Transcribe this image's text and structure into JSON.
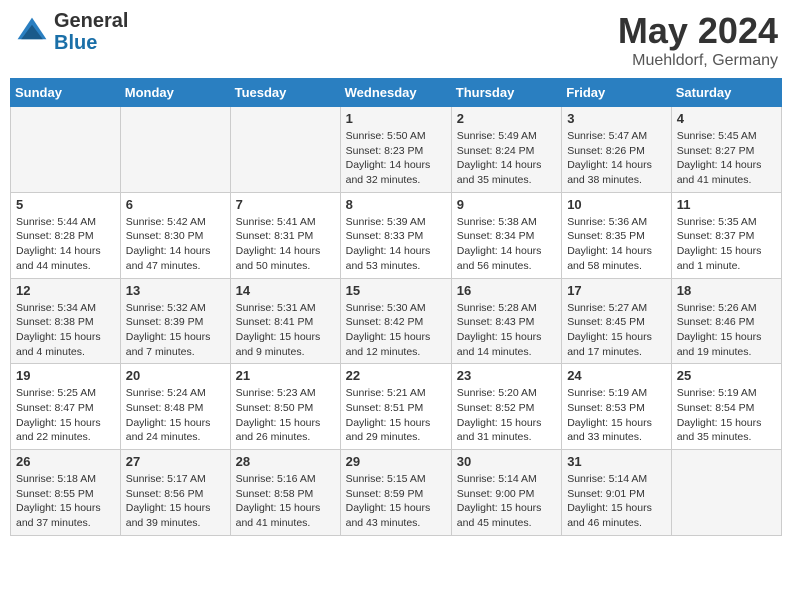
{
  "header": {
    "logo_general": "General",
    "logo_blue": "Blue",
    "title": "May 2024",
    "location": "Muehldorf, Germany"
  },
  "weekdays": [
    "Sunday",
    "Monday",
    "Tuesday",
    "Wednesday",
    "Thursday",
    "Friday",
    "Saturday"
  ],
  "weeks": [
    [
      {
        "day": "",
        "sunrise": "",
        "sunset": "",
        "daylight": ""
      },
      {
        "day": "",
        "sunrise": "",
        "sunset": "",
        "daylight": ""
      },
      {
        "day": "",
        "sunrise": "",
        "sunset": "",
        "daylight": ""
      },
      {
        "day": "1",
        "sunrise": "Sunrise: 5:50 AM",
        "sunset": "Sunset: 8:23 PM",
        "daylight": "Daylight: 14 hours and 32 minutes."
      },
      {
        "day": "2",
        "sunrise": "Sunrise: 5:49 AM",
        "sunset": "Sunset: 8:24 PM",
        "daylight": "Daylight: 14 hours and 35 minutes."
      },
      {
        "day": "3",
        "sunrise": "Sunrise: 5:47 AM",
        "sunset": "Sunset: 8:26 PM",
        "daylight": "Daylight: 14 hours and 38 minutes."
      },
      {
        "day": "4",
        "sunrise": "Sunrise: 5:45 AM",
        "sunset": "Sunset: 8:27 PM",
        "daylight": "Daylight: 14 hours and 41 minutes."
      }
    ],
    [
      {
        "day": "5",
        "sunrise": "Sunrise: 5:44 AM",
        "sunset": "Sunset: 8:28 PM",
        "daylight": "Daylight: 14 hours and 44 minutes."
      },
      {
        "day": "6",
        "sunrise": "Sunrise: 5:42 AM",
        "sunset": "Sunset: 8:30 PM",
        "daylight": "Daylight: 14 hours and 47 minutes."
      },
      {
        "day": "7",
        "sunrise": "Sunrise: 5:41 AM",
        "sunset": "Sunset: 8:31 PM",
        "daylight": "Daylight: 14 hours and 50 minutes."
      },
      {
        "day": "8",
        "sunrise": "Sunrise: 5:39 AM",
        "sunset": "Sunset: 8:33 PM",
        "daylight": "Daylight: 14 hours and 53 minutes."
      },
      {
        "day": "9",
        "sunrise": "Sunrise: 5:38 AM",
        "sunset": "Sunset: 8:34 PM",
        "daylight": "Daylight: 14 hours and 56 minutes."
      },
      {
        "day": "10",
        "sunrise": "Sunrise: 5:36 AM",
        "sunset": "Sunset: 8:35 PM",
        "daylight": "Daylight: 14 hours and 58 minutes."
      },
      {
        "day": "11",
        "sunrise": "Sunrise: 5:35 AM",
        "sunset": "Sunset: 8:37 PM",
        "daylight": "Daylight: 15 hours and 1 minute."
      }
    ],
    [
      {
        "day": "12",
        "sunrise": "Sunrise: 5:34 AM",
        "sunset": "Sunset: 8:38 PM",
        "daylight": "Daylight: 15 hours and 4 minutes."
      },
      {
        "day": "13",
        "sunrise": "Sunrise: 5:32 AM",
        "sunset": "Sunset: 8:39 PM",
        "daylight": "Daylight: 15 hours and 7 minutes."
      },
      {
        "day": "14",
        "sunrise": "Sunrise: 5:31 AM",
        "sunset": "Sunset: 8:41 PM",
        "daylight": "Daylight: 15 hours and 9 minutes."
      },
      {
        "day": "15",
        "sunrise": "Sunrise: 5:30 AM",
        "sunset": "Sunset: 8:42 PM",
        "daylight": "Daylight: 15 hours and 12 minutes."
      },
      {
        "day": "16",
        "sunrise": "Sunrise: 5:28 AM",
        "sunset": "Sunset: 8:43 PM",
        "daylight": "Daylight: 15 hours and 14 minutes."
      },
      {
        "day": "17",
        "sunrise": "Sunrise: 5:27 AM",
        "sunset": "Sunset: 8:45 PM",
        "daylight": "Daylight: 15 hours and 17 minutes."
      },
      {
        "day": "18",
        "sunrise": "Sunrise: 5:26 AM",
        "sunset": "Sunset: 8:46 PM",
        "daylight": "Daylight: 15 hours and 19 minutes."
      }
    ],
    [
      {
        "day": "19",
        "sunrise": "Sunrise: 5:25 AM",
        "sunset": "Sunset: 8:47 PM",
        "daylight": "Daylight: 15 hours and 22 minutes."
      },
      {
        "day": "20",
        "sunrise": "Sunrise: 5:24 AM",
        "sunset": "Sunset: 8:48 PM",
        "daylight": "Daylight: 15 hours and 24 minutes."
      },
      {
        "day": "21",
        "sunrise": "Sunrise: 5:23 AM",
        "sunset": "Sunset: 8:50 PM",
        "daylight": "Daylight: 15 hours and 26 minutes."
      },
      {
        "day": "22",
        "sunrise": "Sunrise: 5:21 AM",
        "sunset": "Sunset: 8:51 PM",
        "daylight": "Daylight: 15 hours and 29 minutes."
      },
      {
        "day": "23",
        "sunrise": "Sunrise: 5:20 AM",
        "sunset": "Sunset: 8:52 PM",
        "daylight": "Daylight: 15 hours and 31 minutes."
      },
      {
        "day": "24",
        "sunrise": "Sunrise: 5:19 AM",
        "sunset": "Sunset: 8:53 PM",
        "daylight": "Daylight: 15 hours and 33 minutes."
      },
      {
        "day": "25",
        "sunrise": "Sunrise: 5:19 AM",
        "sunset": "Sunset: 8:54 PM",
        "daylight": "Daylight: 15 hours and 35 minutes."
      }
    ],
    [
      {
        "day": "26",
        "sunrise": "Sunrise: 5:18 AM",
        "sunset": "Sunset: 8:55 PM",
        "daylight": "Daylight: 15 hours and 37 minutes."
      },
      {
        "day": "27",
        "sunrise": "Sunrise: 5:17 AM",
        "sunset": "Sunset: 8:56 PM",
        "daylight": "Daylight: 15 hours and 39 minutes."
      },
      {
        "day": "28",
        "sunrise": "Sunrise: 5:16 AM",
        "sunset": "Sunset: 8:58 PM",
        "daylight": "Daylight: 15 hours and 41 minutes."
      },
      {
        "day": "29",
        "sunrise": "Sunrise: 5:15 AM",
        "sunset": "Sunset: 8:59 PM",
        "daylight": "Daylight: 15 hours and 43 minutes."
      },
      {
        "day": "30",
        "sunrise": "Sunrise: 5:14 AM",
        "sunset": "Sunset: 9:00 PM",
        "daylight": "Daylight: 15 hours and 45 minutes."
      },
      {
        "day": "31",
        "sunrise": "Sunrise: 5:14 AM",
        "sunset": "Sunset: 9:01 PM",
        "daylight": "Daylight: 15 hours and 46 minutes."
      },
      {
        "day": "",
        "sunrise": "",
        "sunset": "",
        "daylight": ""
      }
    ]
  ]
}
